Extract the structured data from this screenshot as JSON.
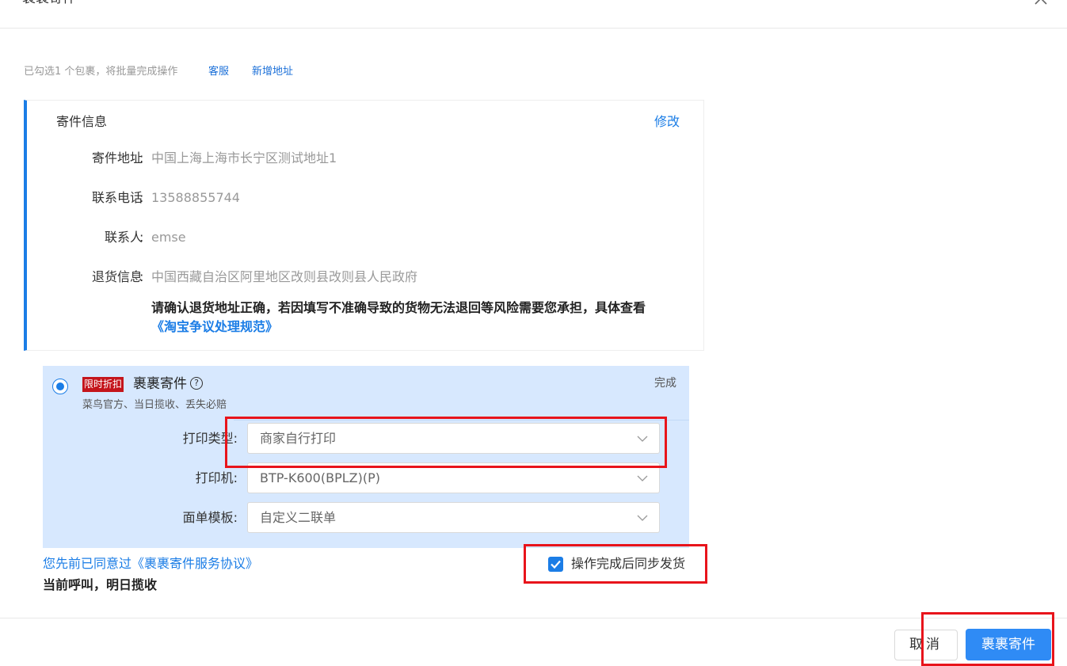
{
  "dialog": {
    "title": "裹裹寄件",
    "close_icon": "close-icon"
  },
  "summary": {
    "text": "已勾选1 个包裹，将批量完成操作",
    "customer_service": "客服",
    "add_address": "新增地址"
  },
  "sender": {
    "title": "寄件信息",
    "modify": "修改",
    "fields": [
      {
        "label": "寄件地址",
        "value": "中国上海上海市长宁区测试地址1"
      },
      {
        "label": "联系电话",
        "value": "13588855744"
      },
      {
        "label": "联系人",
        "value": "emse"
      },
      {
        "label": "退货信息",
        "value": "中国西藏自治区阿里地区改则县改则县人民政府"
      }
    ],
    "colon": ":",
    "warning": "请确认退货地址正确，若因填写不准确导致的货物无法退回等风险需要您承担，具体查看",
    "warning_link": "《淘宝争议处理规范》"
  },
  "service": {
    "badge": "限时折扣",
    "name": "裹裹寄件",
    "help_glyph": "?",
    "status": "完成",
    "description": "菜鸟官方、当日揽收、丢失必赔",
    "fields": [
      {
        "label": "打印类型:",
        "value": "商家自行打印"
      },
      {
        "label": "打印机:",
        "value": "BTP-K600(BPLZ)(P)"
      },
      {
        "label": "面单模板:",
        "value": "自定义二联单"
      }
    ]
  },
  "agreement": {
    "link": "您先前已同意过《裹裹寄件服务协议》",
    "pickup": "当前呼叫，明日揽收",
    "sync_checkbox_label": "操作完成后同步发货",
    "sync_checked": true
  },
  "footer": {
    "cancel": "取消",
    "submit": "裹裹寄件"
  },
  "colors": {
    "accent": "#1b7de6",
    "primary_button": "#2f8bf5",
    "service_bg": "#d7e8fe",
    "badge_red": "#c4151c",
    "annotation_red": "#e8141b"
  }
}
